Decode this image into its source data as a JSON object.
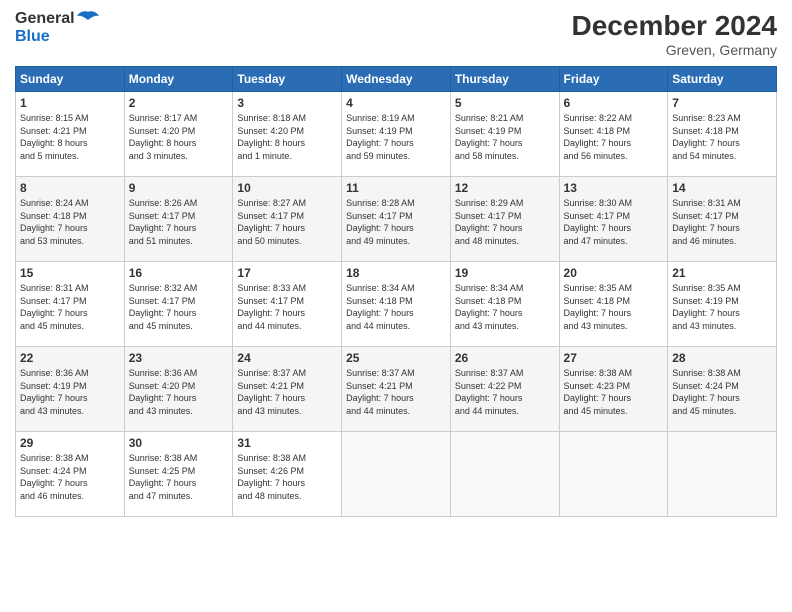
{
  "header": {
    "logo_general": "General",
    "logo_blue": "Blue",
    "month_title": "December 2024",
    "subtitle": "Greven, Germany"
  },
  "days_of_week": [
    "Sunday",
    "Monday",
    "Tuesday",
    "Wednesday",
    "Thursday",
    "Friday",
    "Saturday"
  ],
  "weeks": [
    [
      {
        "day": "1",
        "sunrise": "8:15 AM",
        "sunset": "4:21 PM",
        "daylight": "8 hours and 5 minutes."
      },
      {
        "day": "2",
        "sunrise": "8:17 AM",
        "sunset": "4:20 PM",
        "daylight": "8 hours and 3 minutes."
      },
      {
        "day": "3",
        "sunrise": "8:18 AM",
        "sunset": "4:20 PM",
        "daylight": "8 hours and 1 minute."
      },
      {
        "day": "4",
        "sunrise": "8:19 AM",
        "sunset": "4:19 PM",
        "daylight": "7 hours and 59 minutes."
      },
      {
        "day": "5",
        "sunrise": "8:21 AM",
        "sunset": "4:19 PM",
        "daylight": "7 hours and 58 minutes."
      },
      {
        "day": "6",
        "sunrise": "8:22 AM",
        "sunset": "4:18 PM",
        "daylight": "7 hours and 56 minutes."
      },
      {
        "day": "7",
        "sunrise": "8:23 AM",
        "sunset": "4:18 PM",
        "daylight": "7 hours and 54 minutes."
      }
    ],
    [
      {
        "day": "8",
        "sunrise": "8:24 AM",
        "sunset": "4:18 PM",
        "daylight": "7 hours and 53 minutes."
      },
      {
        "day": "9",
        "sunrise": "8:26 AM",
        "sunset": "4:17 PM",
        "daylight": "7 hours and 51 minutes."
      },
      {
        "day": "10",
        "sunrise": "8:27 AM",
        "sunset": "4:17 PM",
        "daylight": "7 hours and 50 minutes."
      },
      {
        "day": "11",
        "sunrise": "8:28 AM",
        "sunset": "4:17 PM",
        "daylight": "7 hours and 49 minutes."
      },
      {
        "day": "12",
        "sunrise": "8:29 AM",
        "sunset": "4:17 PM",
        "daylight": "7 hours and 48 minutes."
      },
      {
        "day": "13",
        "sunrise": "8:30 AM",
        "sunset": "4:17 PM",
        "daylight": "7 hours and 47 minutes."
      },
      {
        "day": "14",
        "sunrise": "8:31 AM",
        "sunset": "4:17 PM",
        "daylight": "7 hours and 46 minutes."
      }
    ],
    [
      {
        "day": "15",
        "sunrise": "8:31 AM",
        "sunset": "4:17 PM",
        "daylight": "7 hours and 45 minutes."
      },
      {
        "day": "16",
        "sunrise": "8:32 AM",
        "sunset": "4:17 PM",
        "daylight": "7 hours and 45 minutes."
      },
      {
        "day": "17",
        "sunrise": "8:33 AM",
        "sunset": "4:17 PM",
        "daylight": "7 hours and 44 minutes."
      },
      {
        "day": "18",
        "sunrise": "8:34 AM",
        "sunset": "4:18 PM",
        "daylight": "7 hours and 44 minutes."
      },
      {
        "day": "19",
        "sunrise": "8:34 AM",
        "sunset": "4:18 PM",
        "daylight": "7 hours and 43 minutes."
      },
      {
        "day": "20",
        "sunrise": "8:35 AM",
        "sunset": "4:18 PM",
        "daylight": "7 hours and 43 minutes."
      },
      {
        "day": "21",
        "sunrise": "8:35 AM",
        "sunset": "4:19 PM",
        "daylight": "7 hours and 43 minutes."
      }
    ],
    [
      {
        "day": "22",
        "sunrise": "8:36 AM",
        "sunset": "4:19 PM",
        "daylight": "7 hours and 43 minutes."
      },
      {
        "day": "23",
        "sunrise": "8:36 AM",
        "sunset": "4:20 PM",
        "daylight": "7 hours and 43 minutes."
      },
      {
        "day": "24",
        "sunrise": "8:37 AM",
        "sunset": "4:21 PM",
        "daylight": "7 hours and 43 minutes."
      },
      {
        "day": "25",
        "sunrise": "8:37 AM",
        "sunset": "4:21 PM",
        "daylight": "7 hours and 44 minutes."
      },
      {
        "day": "26",
        "sunrise": "8:37 AM",
        "sunset": "4:22 PM",
        "daylight": "7 hours and 44 minutes."
      },
      {
        "day": "27",
        "sunrise": "8:38 AM",
        "sunset": "4:23 PM",
        "daylight": "7 hours and 45 minutes."
      },
      {
        "day": "28",
        "sunrise": "8:38 AM",
        "sunset": "4:24 PM",
        "daylight": "7 hours and 45 minutes."
      }
    ],
    [
      {
        "day": "29",
        "sunrise": "8:38 AM",
        "sunset": "4:24 PM",
        "daylight": "7 hours and 46 minutes."
      },
      {
        "day": "30",
        "sunrise": "8:38 AM",
        "sunset": "4:25 PM",
        "daylight": "7 hours and 47 minutes."
      },
      {
        "day": "31",
        "sunrise": "8:38 AM",
        "sunset": "4:26 PM",
        "daylight": "7 hours and 48 minutes."
      },
      null,
      null,
      null,
      null
    ]
  ]
}
